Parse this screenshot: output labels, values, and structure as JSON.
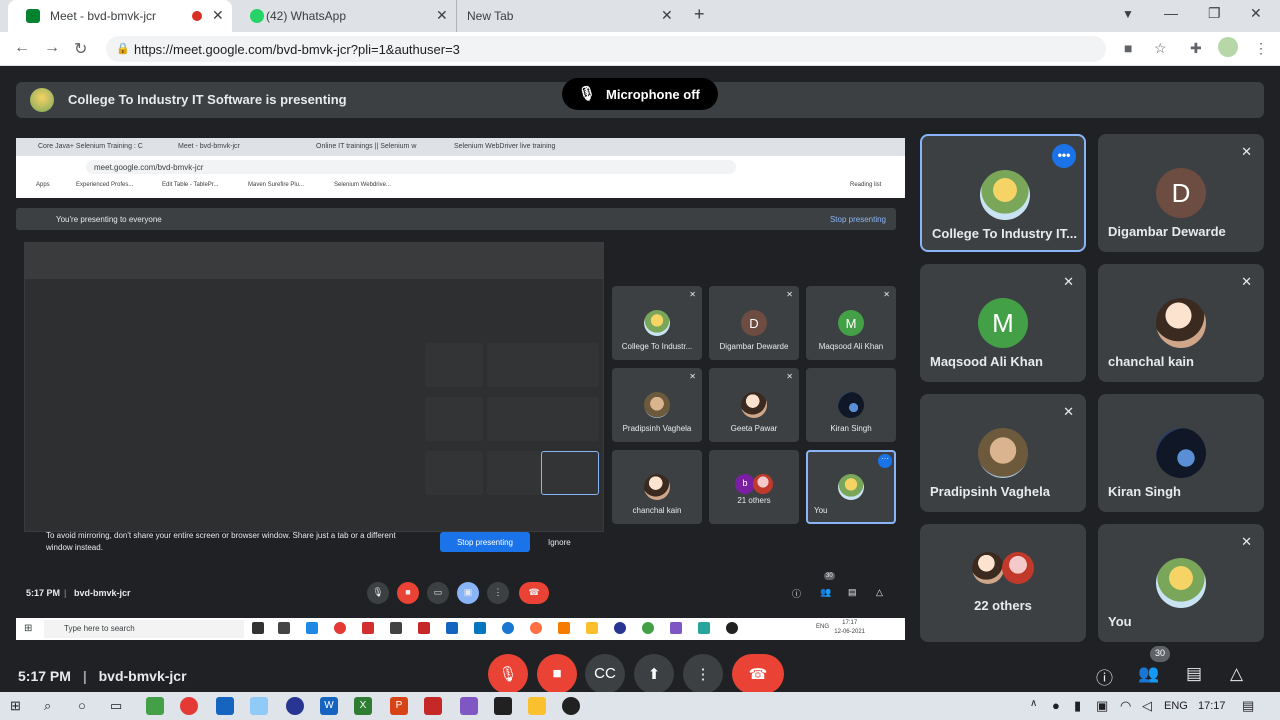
{
  "browser": {
    "tabs": [
      {
        "title": "Meet - bvd-bmvk-jcr",
        "active": true
      },
      {
        "title": "(42) WhatsApp",
        "active": false
      },
      {
        "title": "New Tab",
        "active": false
      }
    ],
    "new_tab_symbol": "+",
    "url": "https://meet.google.com/bvd-bmvk-jcr?pli=1&authuser=3"
  },
  "presentation": {
    "presenter_text": "College To Industry IT Software is presenting",
    "mic_status": "Microphone off"
  },
  "shared_screen": {
    "tabs": [
      "Core Java+ Selenium Training : C",
      "Meet - bvd-bmvk-jcr",
      "Online IT trainings || Selenium w",
      "Selenium WebDriver live training"
    ],
    "url": "meet.google.com/bvd-bmvk-jcr",
    "bookmarks": [
      "Apps",
      "Experienced Profes...",
      "Edit Table - TablePr...",
      "Maven Surefire Plu...",
      "Selenium Webdrive..."
    ],
    "reading_list": "Reading list",
    "presenting_text": "You're presenting to everyone",
    "stop_presenting_link": "Stop presenting",
    "mirror_warning": "To avoid mirroring, don't share your entire screen or browser window. Share just a tab or a different window instead.",
    "stop_presenting_button": "Stop presenting",
    "ignore_button": "Ignore",
    "tiles": [
      {
        "name": "College To Industr...",
        "initial": "",
        "color": "",
        "photo": "photo4"
      },
      {
        "name": "Digambar Dewarde",
        "initial": "D",
        "color": "#6d4c41",
        "photo": ""
      },
      {
        "name": "Maqsood Ali Khan",
        "initial": "M",
        "color": "#43a047",
        "photo": ""
      },
      {
        "name": "Pradipsinh Vaghela",
        "initial": "",
        "color": "",
        "photo": "photo2"
      },
      {
        "name": "Geeta Pawar",
        "initial": "",
        "color": "",
        "photo": "photo1"
      },
      {
        "name": "Kiran Singh",
        "initial": "",
        "color": "",
        "photo": "photo3"
      },
      {
        "name": "chanchal kain",
        "initial": "",
        "color": "",
        "photo": "photo1"
      },
      {
        "name": "21 others",
        "initial": "b",
        "color": "#7b1fa2",
        "photo": ""
      },
      {
        "name": "You",
        "initial": "",
        "color": "",
        "photo": "photo4"
      }
    ],
    "time": "5:17 PM",
    "meeting_code": "bvd-bmvk-jcr",
    "participant_count": "30",
    "search_placeholder": "Type here to search",
    "taskbar_lang": "ENG",
    "taskbar_time": "17:17",
    "taskbar_date": "12-06-2021"
  },
  "tiles": [
    {
      "name": "College To Industry IT...",
      "initial": "",
      "color": "",
      "photo": "photo4",
      "highlight": true
    },
    {
      "name": "Digambar Dewarde",
      "initial": "D",
      "color": "#6d4c41",
      "photo": ""
    },
    {
      "name": "Maqsood Ali Khan",
      "initial": "M",
      "color": "#43a047",
      "photo": ""
    },
    {
      "name": "chanchal kain",
      "initial": "",
      "color": "",
      "photo": "photo1"
    },
    {
      "name": "Pradipsinh Vaghela",
      "initial": "",
      "color": "",
      "photo": "photo2"
    },
    {
      "name": "Kiran Singh",
      "initial": "",
      "color": "",
      "photo": "photo3"
    },
    {
      "name": "22 others",
      "initial": "",
      "color": "",
      "photo": "photo5"
    },
    {
      "name": "You",
      "initial": "",
      "color": "",
      "photo": "photo4"
    }
  ],
  "controls": {
    "time": "5:17 PM",
    "separator": "|",
    "meeting_code": "bvd-bmvk-jcr",
    "participant_count": "30"
  },
  "taskbar": {
    "lang": "ENG",
    "time": "17:17"
  },
  "colors": {
    "meet_bg": "#202124",
    "tile_bg": "#3c4043",
    "accent_blue": "#1a73e8",
    "highlight": "#8ab4f8",
    "danger_red": "#ea4335"
  }
}
